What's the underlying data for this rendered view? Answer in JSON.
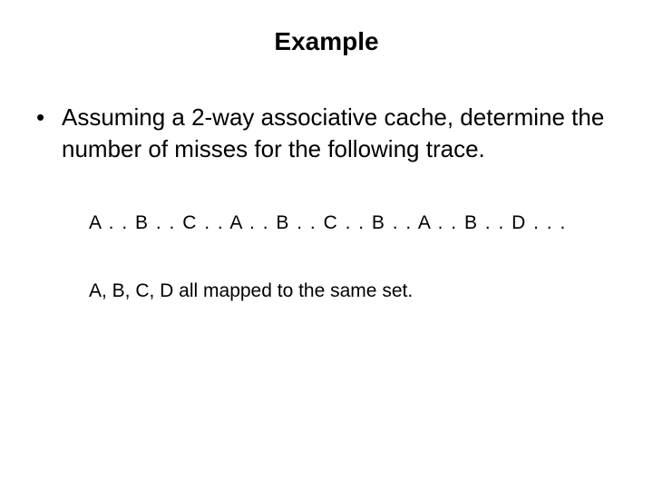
{
  "title": "Example",
  "bullet": {
    "mark": "•",
    "text": "Assuming a 2-way associative cache, determine the number of misses for the following trace."
  },
  "trace": "A . . B . . C . . A . . B . . C . . B . . A . . B . . D . . .",
  "note": "A, B, C, D all mapped to the same set."
}
